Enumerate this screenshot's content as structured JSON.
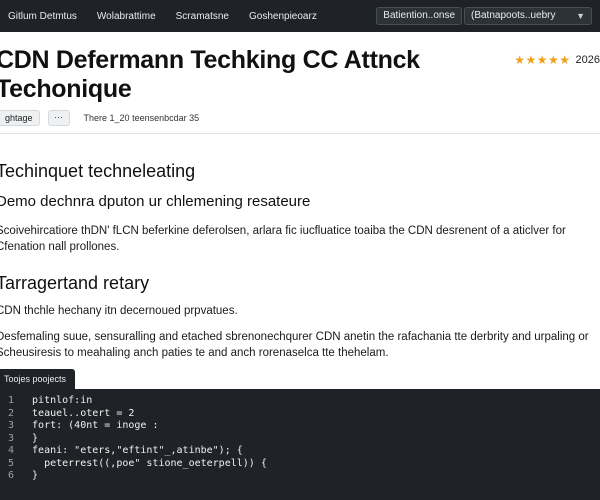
{
  "topbar": {
    "nav": [
      "Gitlum Detmtus",
      "Wolabrattime",
      "Scramatsne",
      "Goshenpieoarz"
    ],
    "search_label": "Batiention..onse",
    "select_value": "(Batnapoots..uebry",
    "select_icon": "chevron-down-icon"
  },
  "article": {
    "title_line1": "CDN Defermann Techking CC Attnck",
    "title_line2": "Techonique",
    "rating_stars": "★★★★★",
    "rating_value": 5,
    "rating_year": "2026",
    "tag": "ghtage",
    "more_label": "···",
    "date": "There 1_20 teensenbcdar 35",
    "section1_heading": "Techinquet techneleating",
    "section1_subheading": "Demo dechnra dputon ur chlemening resateure",
    "section1_para": "Scoivehircatiore thDN' fLCN beferkine deferolsen, arlara fic iucfluatice toaiba the CDN desrenent of a aticlver for Cfenation nall prollones.",
    "section2_heading": "Tarragertand retary",
    "section2_line": "CDN thchle hechany itn decernoued prpvatues.",
    "section2_para": "Desfemaling suue, sensuralling and etached sbrenonechqurer CDN anetin the rafachania tte derbrity and urpaling or Scheusiresis to meahaling anch paties te and anch rorenaselca tte thehelam."
  },
  "code": {
    "tab": "Toojes poojects",
    "lines": [
      {
        "n": "1",
        "t": "  pitnlof:in"
      },
      {
        "n": "2",
        "t": "  teauel..otert = 2"
      },
      {
        "n": "3",
        "t": "  fort: (40nt = inoge :"
      },
      {
        "n": "3",
        "t": "  }"
      },
      {
        "n": "4",
        "t": "  feani: \"eters,\"eftint\"_,atinbe\"); {"
      },
      {
        "n": "5",
        "t": "    peterrest((,poe\" stione_oeterpell)) {"
      },
      {
        "n": "6",
        "t": "  }"
      }
    ]
  },
  "colors": {
    "topbar_bg": "#1f2227",
    "code_bg": "#1f2227",
    "star": "#f2a01c",
    "text": "#111111"
  }
}
